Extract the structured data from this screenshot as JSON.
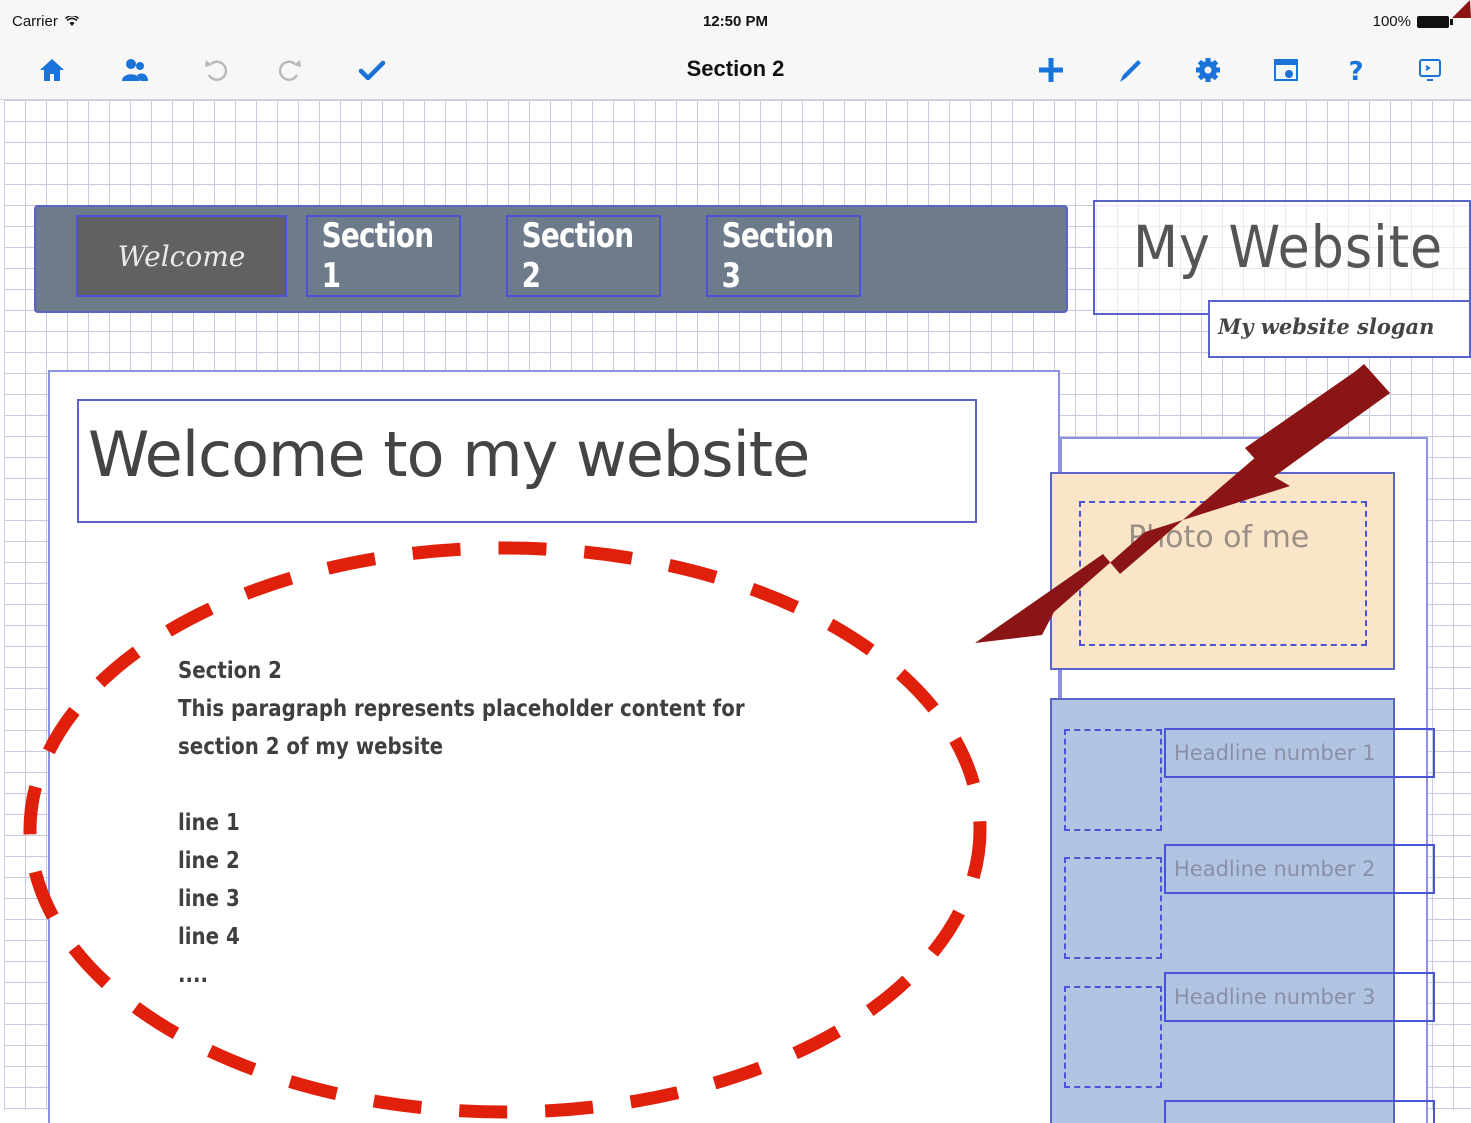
{
  "status_bar": {
    "carrier": "Carrier",
    "time": "12:50 PM",
    "battery": "100%"
  },
  "toolbar": {
    "title": "Section 2",
    "left_icons": [
      "home-icon",
      "users-icon",
      "undo-icon",
      "redo-icon",
      "checkmark-icon"
    ],
    "right_icons": [
      "plus-icon",
      "pen-icon",
      "gear-icon",
      "preview-icon",
      "help-icon",
      "publish-icon"
    ],
    "accent_color": "#1a73d9"
  },
  "nav": {
    "items": [
      {
        "label": "Welcome",
        "active": true
      },
      {
        "label": "Section 1",
        "active": false
      },
      {
        "label": "Section 2",
        "active": false
      },
      {
        "label": "Section 3",
        "active": false
      }
    ],
    "bar_color": "#6e7b8a"
  },
  "site": {
    "title": "My Website",
    "slogan": "My website slogan"
  },
  "main": {
    "heading": "Welcome to my website",
    "content": {
      "title": "Section 2",
      "paragraph": "This paragraph represents placeholder content for section 2 of my website",
      "lines": [
        "line 1",
        "line 2",
        "line 3",
        "line 4",
        "...."
      ]
    }
  },
  "sidebar": {
    "photo_label": "Photo of me",
    "photo_bg": "#fbe5c9",
    "news_bg": "#b1c5e3",
    "headlines": [
      "Headline number 1",
      "Headline number 2",
      "Headline number 3"
    ]
  },
  "annotations": {
    "color_arrow": "#8b1414",
    "color_ellipse": "#e0200b"
  }
}
